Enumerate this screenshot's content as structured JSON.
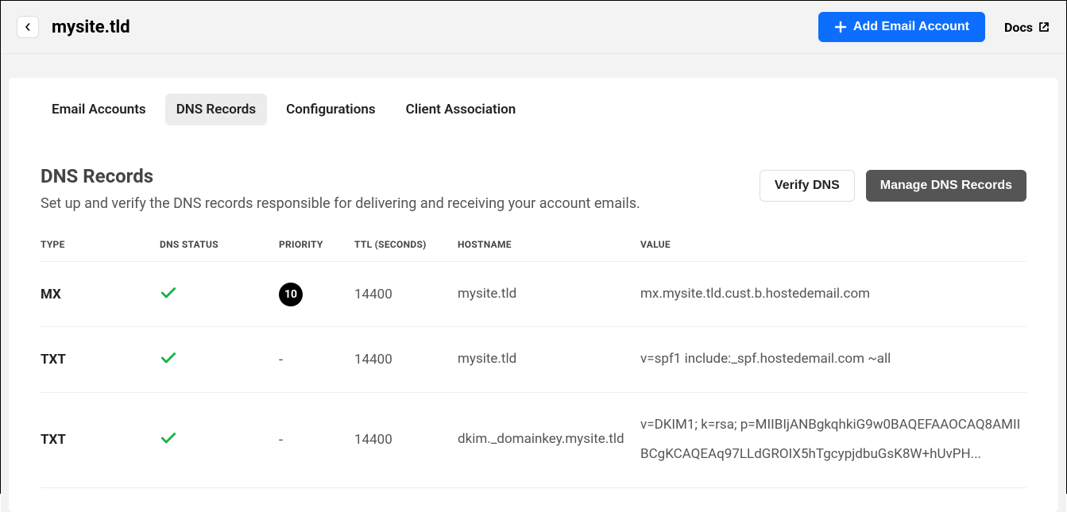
{
  "header": {
    "title": "mysite.tld",
    "primary_button": "Add Email Account",
    "docs_label": "Docs"
  },
  "tabs": [
    {
      "label": "Email Accounts",
      "active": false
    },
    {
      "label": "DNS Records",
      "active": true
    },
    {
      "label": "Configurations",
      "active": false
    },
    {
      "label": "Client Association",
      "active": false
    }
  ],
  "section": {
    "title": "DNS Records",
    "description": "Set up and verify the DNS records responsible for delivering and receiving your account emails.",
    "verify_btn": "Verify DNS",
    "manage_btn": "Manage DNS Records"
  },
  "table": {
    "headers": {
      "type": "TYPE",
      "status": "DNS STATUS",
      "priority": "PRIORITY",
      "ttl": "TTL (SECONDS)",
      "hostname": "HOSTNAME",
      "value": "VALUE"
    },
    "rows": [
      {
        "type": "MX",
        "status_ok": true,
        "priority": "10",
        "ttl": "14400",
        "hostname": "mysite.tld",
        "value": "mx.mysite.tld.cust.b.hostedemail.com"
      },
      {
        "type": "TXT",
        "status_ok": true,
        "priority": "-",
        "ttl": "14400",
        "hostname": "mysite.tld",
        "value": "v=spf1 include:_spf.hostedemail.com ~all"
      },
      {
        "type": "TXT",
        "status_ok": true,
        "priority": "-",
        "ttl": "14400",
        "hostname": "dkim._domainkey.mysite.tld",
        "value": "v=DKIM1; k=rsa; p=MIIBIjANBgkqhkiG9w0BAQEFAAOCAQ8AMIIBCgKCAQEAq97LLdGROIX5hTgcypjdbuGsK8W+hUvPH..."
      }
    ]
  }
}
